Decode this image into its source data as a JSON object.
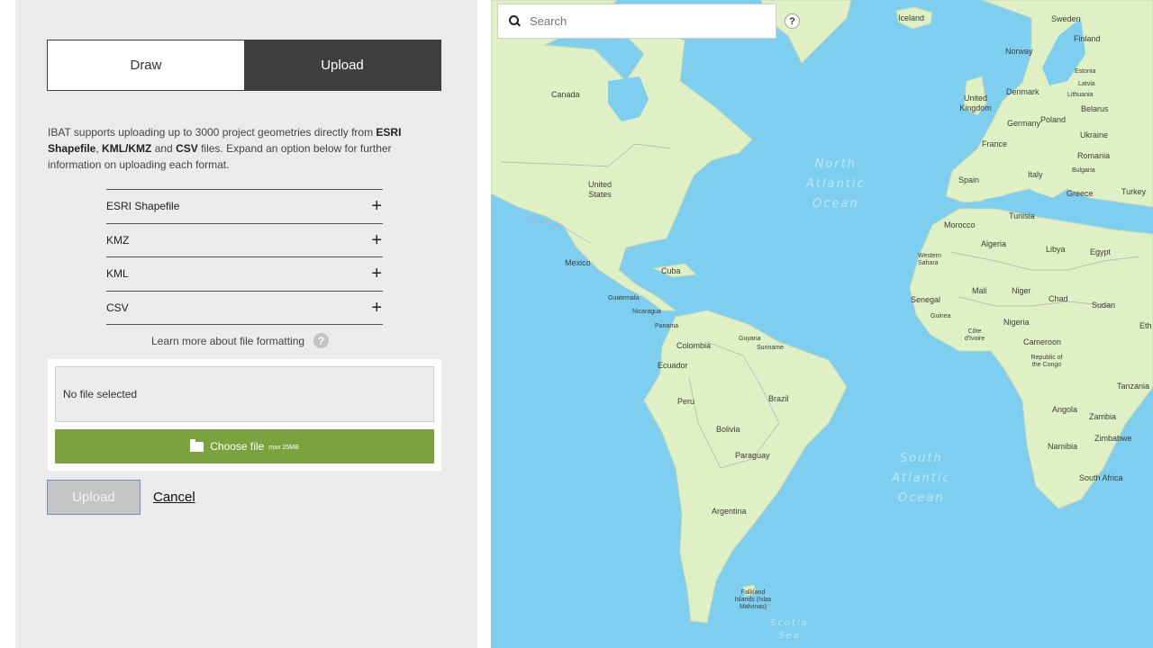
{
  "mode_tabs": {
    "draw": "Draw",
    "upload": "Upload"
  },
  "intro": {
    "part1": "IBAT supports uploading up to 3000 project geometries directly from ",
    "bold1": "ESRI Shapefile",
    "part2": ", ",
    "bold2": "KML/KMZ",
    "part3": " and ",
    "bold3": "CSV",
    "part4": " files. Expand an option below for further information on uploading each format."
  },
  "formats": [
    {
      "label": "ESRI Shapefile",
      "icon": "+"
    },
    {
      "label": "KMZ",
      "icon": "+"
    },
    {
      "label": "KML",
      "icon": "+"
    },
    {
      "label": "CSV",
      "icon": "+"
    }
  ],
  "learn_more": {
    "label": "Learn more about file formatting",
    "icon": "?"
  },
  "file": {
    "status": "No file selected",
    "choose_label": "Choose file",
    "max_label": "max 25MB"
  },
  "actions": {
    "upload": "Upload",
    "cancel": "Cancel"
  },
  "map": {
    "search_placeholder": "Search",
    "help_icon": "?",
    "oceans": {
      "north_atlantic": [
        "North",
        "Atlantic",
        "Ocean"
      ],
      "south_atlantic": [
        "South",
        "Atlantic",
        "Ocean"
      ],
      "scotia": [
        "Scotia",
        "Sea"
      ]
    },
    "labels": {
      "iceland": "Iceland",
      "sweden": "Sweden",
      "finland": "Finland",
      "norway": "Norway",
      "estonia": "Estonia",
      "latvia": "Latvia",
      "lithuania": "Lithuania",
      "belarus": "Belarus",
      "denmark": "Denmark",
      "united_kingdom": "United Kingdom",
      "germany": "Germany",
      "poland": "Poland",
      "ukraine": "Ukraine",
      "france": "France",
      "romania": "Romania",
      "bulgaria": "Bulgaria",
      "spain": "Spain",
      "italy": "Italy",
      "greece": "Greece",
      "turkey": "Turkey",
      "canada": "Canada",
      "united_states": "United States",
      "mexico": "Mexico",
      "cuba": "Cuba",
      "guatemala": "Guatemala",
      "nicaragua": "Nicaragua",
      "panama": "Panama",
      "colombia": "Colombia",
      "guyana": "Guyana",
      "suriname": "Suriname",
      "ecuador": "Ecuador",
      "peru": "Peru",
      "brazil": "Brazil",
      "bolivia": "Bolivia",
      "paraguay": "Paraguay",
      "argentina": "Argentina",
      "falklands": "Falkland Islands (Islas Malvinas)",
      "morocco": "Morocco",
      "tunisia": "Tunisia",
      "algeria": "Algeria",
      "libya": "Libya",
      "egypt": "Egypt",
      "western_sahara": "Western Sahara",
      "mali": "Mali",
      "niger": "Niger",
      "chad": "Chad",
      "sudan": "Sudan",
      "senegal": "Senegal",
      "guinea": "Guinea",
      "cote_divoire": "Côte d'Ivoire",
      "nigeria": "Nigeria",
      "cameroon": "Cameroon",
      "congo": "Republic of the Congo",
      "tanzania": "Tanzania",
      "angola": "Angola",
      "zambia": "Zambia",
      "zimbabwe": "Zimbabwe",
      "namibia": "Namibia",
      "south_africa": "South Africa",
      "ethiopia": "Eth"
    }
  }
}
